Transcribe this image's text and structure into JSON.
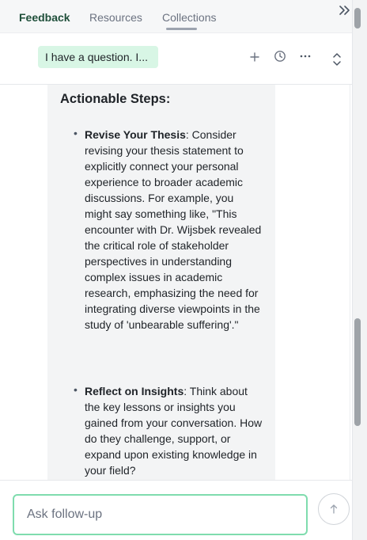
{
  "tabs": [
    {
      "label": "Feedback",
      "active": true
    },
    {
      "label": "Resources",
      "active": false
    },
    {
      "label": "Collections",
      "active": false
    }
  ],
  "toolbar": {
    "thread_title": "I have a question. I...",
    "icons": [
      "plus-icon",
      "history-icon",
      "more-icon",
      "expand-collapse-icon"
    ]
  },
  "content": {
    "heading": "Actionable Steps:",
    "items": [
      {
        "title": "Revise Your Thesis",
        "body": ": Consider revising your thesis statement to explicitly connect your personal experience to broader academic discussions. For example, you might say something like, \"This encounter with Dr. Wijsbek revealed the critical role of stakeholder perspectives in understanding complex issues in academic research, emphasizing the need for integrating diverse viewpoints in the study of 'unbearable suffering'.\""
      },
      {
        "title": "Reflect on Insights",
        "body": ": Think about the key lessons or insights you gained from your conversation. How do they challenge, support, or expand upon existing knowledge in your field?"
      }
    ]
  },
  "followup": {
    "placeholder": "Ask follow-up",
    "value": ""
  },
  "colors": {
    "accent_green": "#7fdcae",
    "chip_bg": "#d8f6e5",
    "active_tab": "#1f4f3a",
    "card_bg": "#f3f4f5"
  },
  "bullet_glyph": "•"
}
